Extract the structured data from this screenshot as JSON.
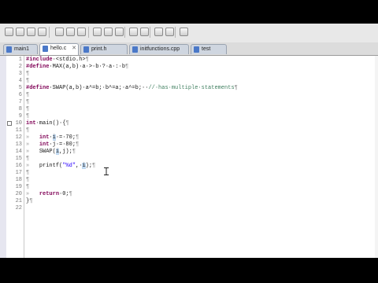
{
  "tabs": [
    {
      "label": "main1"
    },
    {
      "label": "hello.c",
      "active": true
    },
    {
      "label": "print.h"
    },
    {
      "label": "initfunctions.cpp"
    },
    {
      "label": "test"
    }
  ],
  "code_lines": [
    {
      "n": "1",
      "tokens": [
        {
          "t": "#include",
          "c": "pp"
        },
        {
          "t": "·<stdio.h>"
        },
        {
          "t": "¶",
          "c": "ws"
        }
      ]
    },
    {
      "n": "2",
      "tokens": [
        {
          "t": "#define",
          "c": "pp"
        },
        {
          "t": "·MAX(a,b)·a·>·b·?·a·:·b"
        },
        {
          "t": "¶",
          "c": "ws"
        }
      ]
    },
    {
      "n": "3",
      "tokens": [
        {
          "t": "¶",
          "c": "ws"
        }
      ]
    },
    {
      "n": "4",
      "tokens": [
        {
          "t": "¶",
          "c": "ws"
        }
      ]
    },
    {
      "n": "5",
      "tokens": [
        {
          "t": "#define",
          "c": "pp"
        },
        {
          "t": "·SWAP(a,b)·a^=b;·b^=a;·a^=b;··"
        },
        {
          "t": "//·has·multiple·statements",
          "c": "cm"
        },
        {
          "t": "¶",
          "c": "ws"
        }
      ]
    },
    {
      "n": "6",
      "tokens": [
        {
          "t": "¶",
          "c": "ws"
        }
      ]
    },
    {
      "n": "7",
      "tokens": [
        {
          "t": "¶",
          "c": "ws"
        }
      ]
    },
    {
      "n": "8",
      "tokens": [
        {
          "t": "¶",
          "c": "ws"
        }
      ]
    },
    {
      "n": "9",
      "tokens": [
        {
          "t": "¶",
          "c": "ws"
        }
      ]
    },
    {
      "n": "10",
      "fold": true,
      "tokens": [
        {
          "t": "int",
          "c": "kw"
        },
        {
          "t": "·main()·{"
        },
        {
          "t": "¶",
          "c": "ws"
        }
      ]
    },
    {
      "n": "11",
      "tokens": [
        {
          "t": "¶",
          "c": "ws"
        }
      ]
    },
    {
      "n": "12",
      "tokens": [
        {
          "t": "»   ",
          "c": "ws"
        },
        {
          "t": "int",
          "c": "kw"
        },
        {
          "t": "·"
        },
        {
          "t": "i",
          "c": "hl"
        },
        {
          "t": "·=·70;"
        },
        {
          "t": "¶",
          "c": "ws"
        }
      ]
    },
    {
      "n": "13",
      "tokens": [
        {
          "t": "»   ",
          "c": "ws"
        },
        {
          "t": "int",
          "c": "kw"
        },
        {
          "t": "·j·=·80;"
        },
        {
          "t": "¶",
          "c": "ws"
        }
      ]
    },
    {
      "n": "14",
      "tokens": [
        {
          "t": "»   ",
          "c": "ws"
        },
        {
          "t": "SWAP("
        },
        {
          "t": "i",
          "c": "hl"
        },
        {
          "t": ",j);"
        },
        {
          "t": "¶",
          "c": "ws"
        }
      ]
    },
    {
      "n": "15",
      "tokens": [
        {
          "t": "¶",
          "c": "ws"
        }
      ]
    },
    {
      "n": "16",
      "tokens": [
        {
          "t": "»   ",
          "c": "ws"
        },
        {
          "t": "printf("
        },
        {
          "t": "\"%d\"",
          "c": "str"
        },
        {
          "t": ",·"
        },
        {
          "t": "i",
          "c": "hl"
        },
        {
          "t": ");"
        },
        {
          "t": "¶",
          "c": "ws"
        }
      ]
    },
    {
      "n": "17",
      "tokens": [
        {
          "t": "¶",
          "c": "ws"
        }
      ]
    },
    {
      "n": "18",
      "tokens": [
        {
          "t": "¶",
          "c": "ws"
        }
      ]
    },
    {
      "n": "19",
      "tokens": [
        {
          "t": "¶",
          "c": "ws"
        }
      ]
    },
    {
      "n": "20",
      "tokens": [
        {
          "t": "»   ",
          "c": "ws"
        },
        {
          "t": "return",
          "c": "kw"
        },
        {
          "t": "·0;"
        },
        {
          "t": "¶",
          "c": "ws"
        }
      ]
    },
    {
      "n": "21",
      "tokens": [
        {
          "t": "}"
        },
        {
          "t": "¶",
          "c": "ws"
        }
      ]
    },
    {
      "n": "22",
      "tokens": []
    }
  ],
  "icons": {
    "toolbar": [
      "new-icon",
      "open-icon",
      "save-icon",
      "save-all-icon",
      "print-icon",
      "build-icon",
      "debug-icon",
      "run-icon",
      "search-icon",
      "back-icon",
      "forward-icon",
      "next-annotation-icon",
      "prev-annotation-icon",
      "external-tools-icon",
      "perspective-icon"
    ],
    "file": "c-file-icon",
    "close": "close-icon",
    "text_cursor": "text-cursor-icon"
  }
}
